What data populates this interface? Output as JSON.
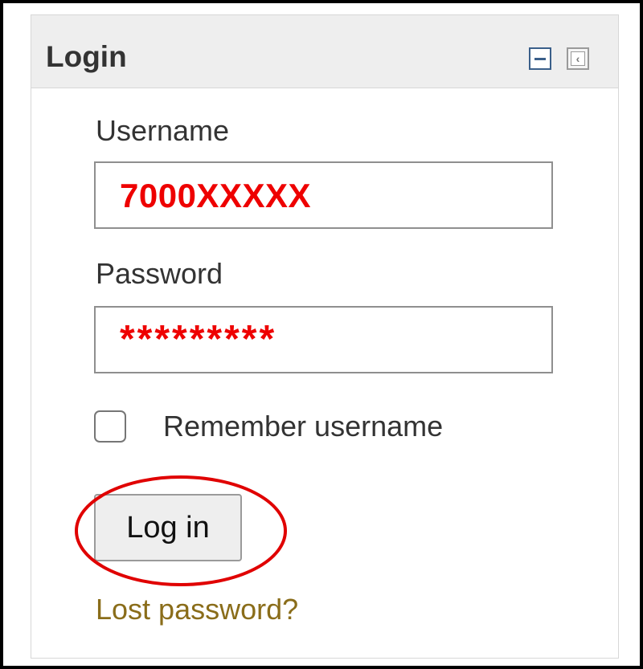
{
  "block": {
    "title": "Login",
    "hide_icon": "minus-icon",
    "dock_icon": "chevron-left-icon"
  },
  "form": {
    "username_label": "Username",
    "username_value": "7000XXXXX",
    "password_label": "Password",
    "password_value": "*********",
    "remember_label": "Remember username",
    "remember_checked": false,
    "login_button": "Log in",
    "lost_password_link": "Lost password?"
  },
  "colors": {
    "annotation_red": "#ee0000",
    "link": "#8a6d1a",
    "header_bg": "#eeeeee"
  }
}
